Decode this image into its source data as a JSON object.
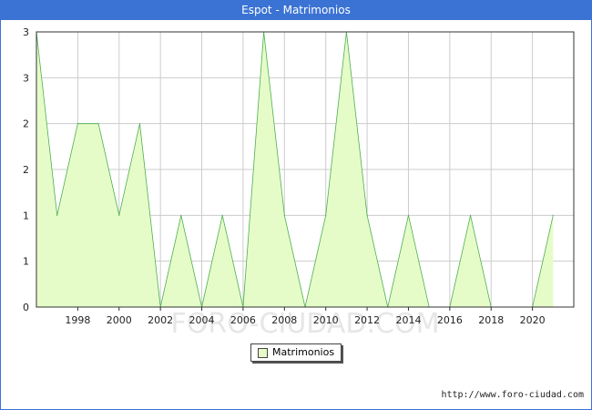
{
  "header": {
    "title": "Espot - Matrimonios"
  },
  "legend": {
    "label": "Matrimonios"
  },
  "source": {
    "text": "http://www.foro-ciudad.com"
  },
  "watermark": {
    "text": "FORO-CIUDAD.COM"
  },
  "colors": {
    "title_bar": "#3b73d4",
    "fill": "#e6fcc8",
    "line": "#4caf50",
    "grid": "#cccccc"
  },
  "chart_data": {
    "type": "area",
    "title": "Espot - Matrimonios",
    "x": [
      1996,
      1997,
      1998,
      1999,
      2000,
      2001,
      2002,
      2003,
      2004,
      2005,
      2006,
      2007,
      2008,
      2009,
      2010,
      2011,
      2012,
      2013,
      2014,
      2015,
      2016,
      2017,
      2018,
      2019,
      2020,
      2021
    ],
    "series": [
      {
        "name": "Matrimonios",
        "values": [
          3,
          1,
          2,
          2,
          1,
          2,
          0,
          1,
          0,
          1,
          0,
          3,
          1,
          0,
          1,
          3,
          1,
          0,
          1,
          0,
          0,
          1,
          0,
          0,
          0,
          1
        ]
      }
    ],
    "xlim": [
      1996,
      2022
    ],
    "ylim": [
      0,
      3
    ],
    "x_ticks": [
      1998,
      2000,
      2002,
      2004,
      2006,
      2008,
      2010,
      2012,
      2014,
      2016,
      2018,
      2020
    ],
    "y_tick_labels": [
      "0",
      "1",
      "1",
      "2",
      "2",
      "3",
      "3"
    ],
    "grid": true,
    "legend_position": "bottom-center"
  }
}
